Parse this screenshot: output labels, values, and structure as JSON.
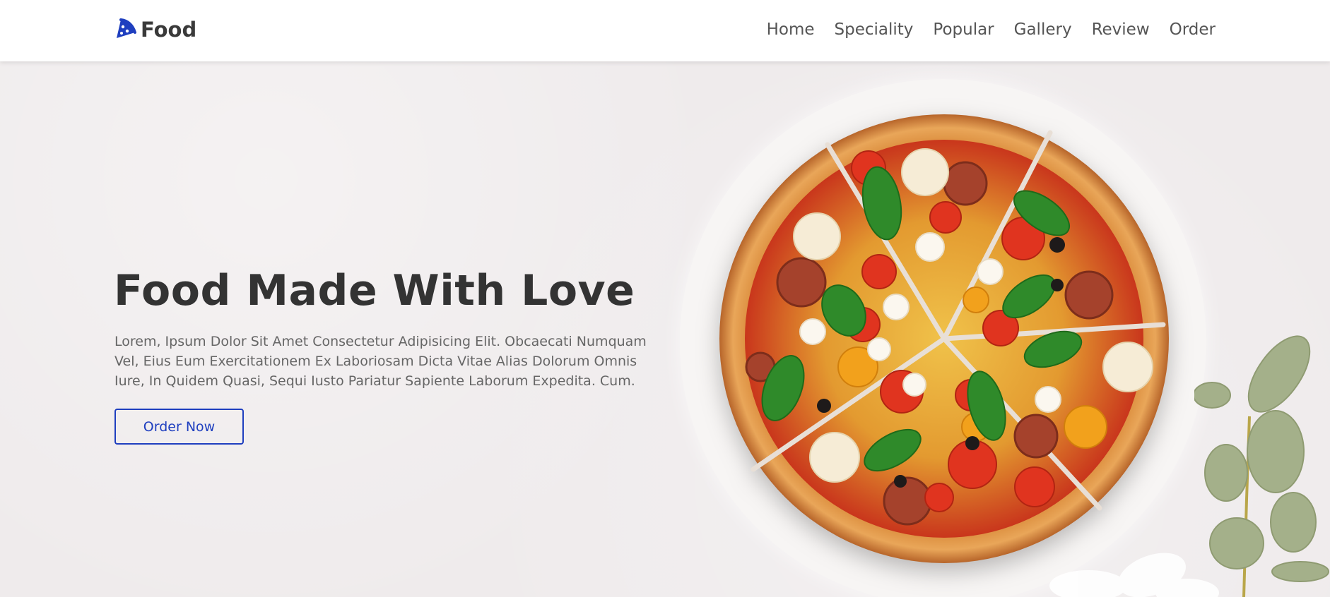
{
  "brand": {
    "name": "Food",
    "icon": "pizza-slice-icon",
    "accent_color": "#1f3fbf"
  },
  "nav": {
    "items": [
      "Home",
      "Speciality",
      "Popular",
      "Gallery",
      "Review",
      "Order"
    ]
  },
  "hero": {
    "title": "Food Made With Love",
    "description": "Lorem, Ipsum Dolor Sit Amet Consectetur Adipisicing Elit. Obcaecati Numquam Vel, Eius Eum Exercitationem Ex Laboriosam Dicta Vitae Alias Dolorum Omnis Iure, In Quidem Quasi, Sequi Iusto Pariatur Sapiente Laborum Expedita. Cum.",
    "button_label": "Order Now",
    "image": "pizza-image"
  }
}
